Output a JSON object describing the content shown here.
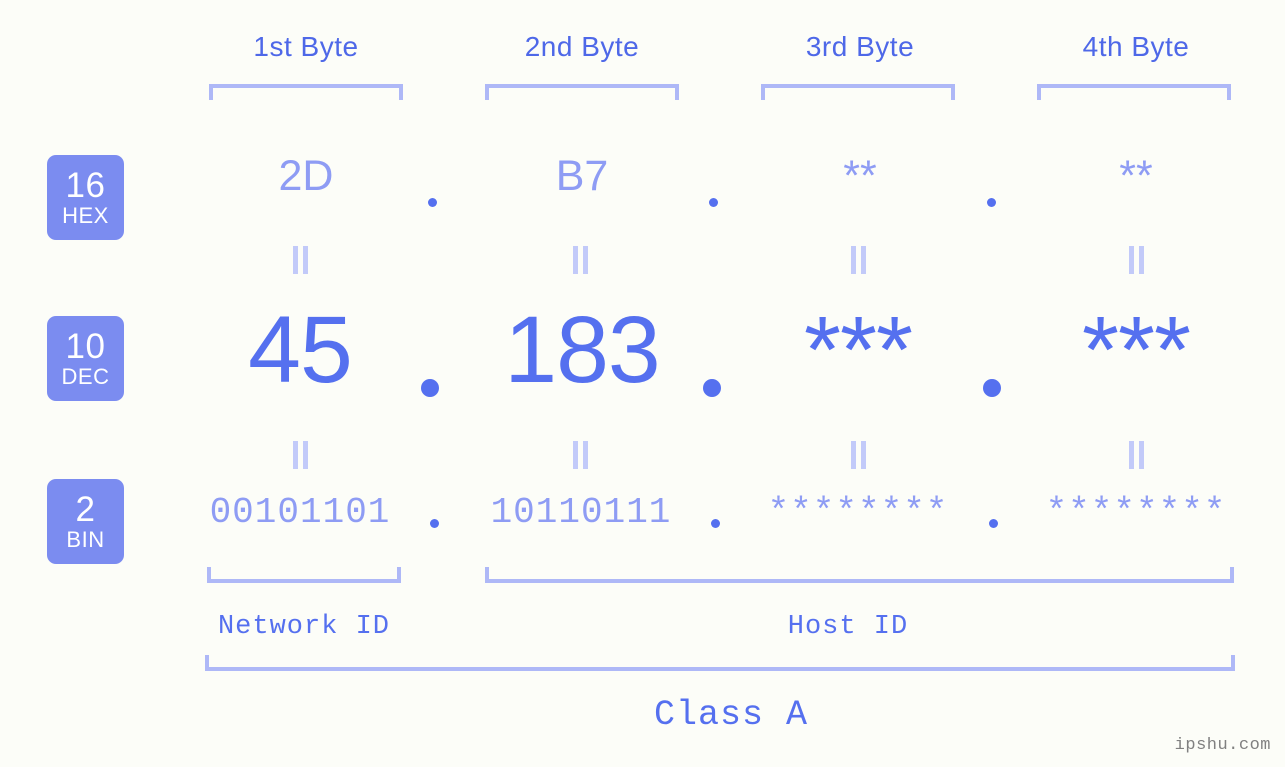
{
  "page": {
    "background_color": "#fcfdf8",
    "accent_color": "#5570ef",
    "accent_light_color": "#8e9cf4",
    "bracket_color": "#aeb8f7",
    "badge_color": "#7b8cf0",
    "watermark": "ipshu.com"
  },
  "byte_headers": [
    {
      "label": "1st Byte"
    },
    {
      "label": "2nd Byte"
    },
    {
      "label": "3rd Byte"
    },
    {
      "label": "4th Byte"
    }
  ],
  "bases": [
    {
      "number": "16",
      "abbr": "HEX"
    },
    {
      "number": "10",
      "abbr": "DEC"
    },
    {
      "number": "2",
      "abbr": "BIN"
    }
  ],
  "rows": {
    "hex": {
      "base_number": "16",
      "base_abbr": "HEX",
      "values": [
        "2D",
        "B7",
        "**",
        "**"
      ],
      "separator": "."
    },
    "dec": {
      "base_number": "10",
      "base_abbr": "DEC",
      "values": [
        "45",
        "183",
        "***",
        "***"
      ],
      "separator": "."
    },
    "bin": {
      "base_number": "2",
      "base_abbr": "BIN",
      "values": [
        "00101101",
        "10110111",
        "********",
        "********"
      ],
      "separator": "."
    }
  },
  "equals_marks": {
    "glyph": "||",
    "count_per_gap": 4,
    "gaps": 2
  },
  "sections": {
    "network_id": "Network ID",
    "host_id": "Host ID",
    "class": "Class A"
  }
}
